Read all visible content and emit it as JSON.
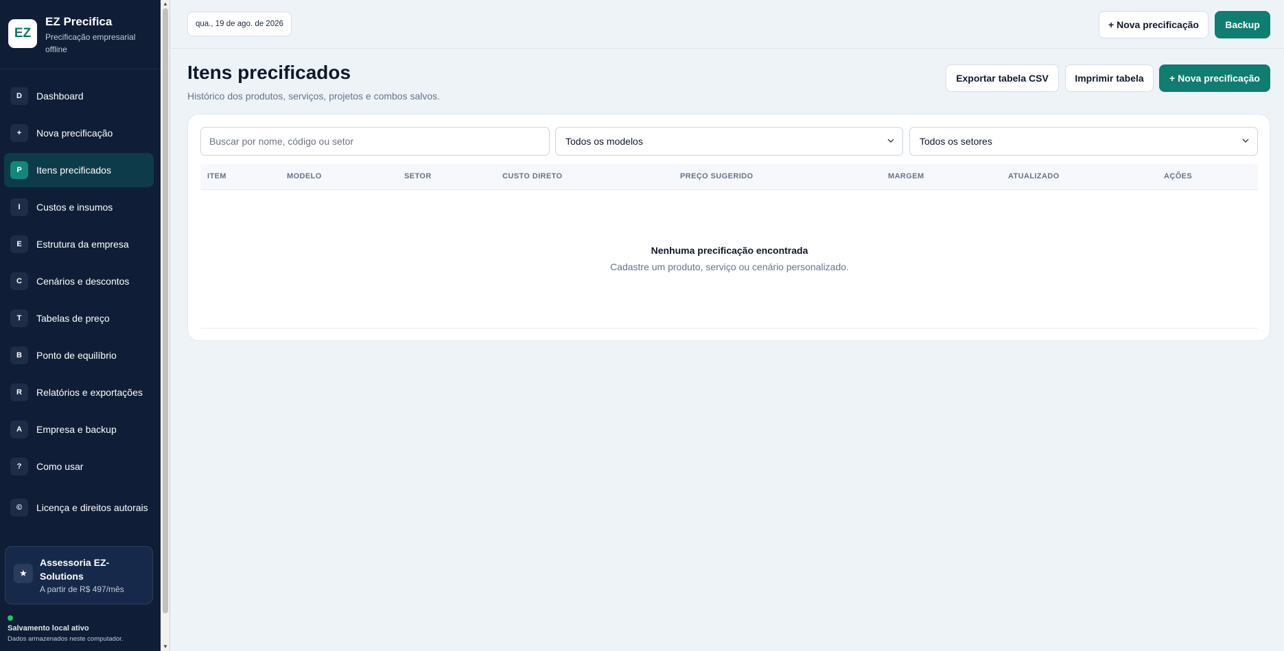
{
  "brand": {
    "logo": "EZ",
    "title": "EZ Precifica",
    "subtitle": "Precificação empresarial offline"
  },
  "nav": [
    {
      "badge": "D",
      "label": "Dashboard",
      "active": false
    },
    {
      "badge": "+",
      "label": "Nova precificação",
      "active": false
    },
    {
      "badge": "P",
      "label": "Itens precificados",
      "active": true
    },
    {
      "badge": "I",
      "label": "Custos e insumos",
      "active": false
    },
    {
      "badge": "E",
      "label": "Estrutura da empresa",
      "active": false
    },
    {
      "badge": "C",
      "label": "Cenários e descontos",
      "active": false
    },
    {
      "badge": "T",
      "label": "Tabelas de preço",
      "active": false
    },
    {
      "badge": "B",
      "label": "Ponto de equilíbrio",
      "active": false
    },
    {
      "badge": "R",
      "label": "Relatórios e exportações",
      "active": false
    },
    {
      "badge": "A",
      "label": "Empresa e backup",
      "active": false
    },
    {
      "badge": "?",
      "label": "Como usar",
      "active": false
    },
    {
      "badge": "©",
      "label": "Licença e direitos autorais",
      "active": false
    }
  ],
  "promo": {
    "icon": "★",
    "title": "Assessoria EZ-Solutions",
    "price": "A partir de R$ 497/mês"
  },
  "status": {
    "title": "Salvamento local ativo",
    "subtitle": "Dados armazenados neste computador."
  },
  "topbar": {
    "date": "qua., 19 de ago. de 2026",
    "new_label": "+ Nova precificação",
    "backup_label": "Backup"
  },
  "header": {
    "title": "Itens precificados",
    "subtitle": "Histórico dos produtos, serviços, projetos e combos salvos.",
    "export_label": "Exportar tabela CSV",
    "print_label": "Imprimir tabela",
    "new_label": "+ Nova precificação"
  },
  "filters": {
    "search_placeholder": "Buscar por nome, código ou setor",
    "model_value": "Todos os modelos",
    "sector_value": "Todos os setores"
  },
  "table": {
    "columns": [
      "ITEM",
      "MODELO",
      "SETOR",
      "CUSTO DIRETO",
      "PREÇO SUGERIDO",
      "MARGEM",
      "ATUALIZADO",
      "AÇÕES"
    ],
    "empty_title": "Nenhuma precificação encontrada",
    "empty_subtitle": "Cadastre um produto, serviço ou cenário personalizado."
  },
  "colors": {
    "sidebar": "#0f1e36",
    "accent": "#0f7d70",
    "background": "#eef3f8"
  }
}
